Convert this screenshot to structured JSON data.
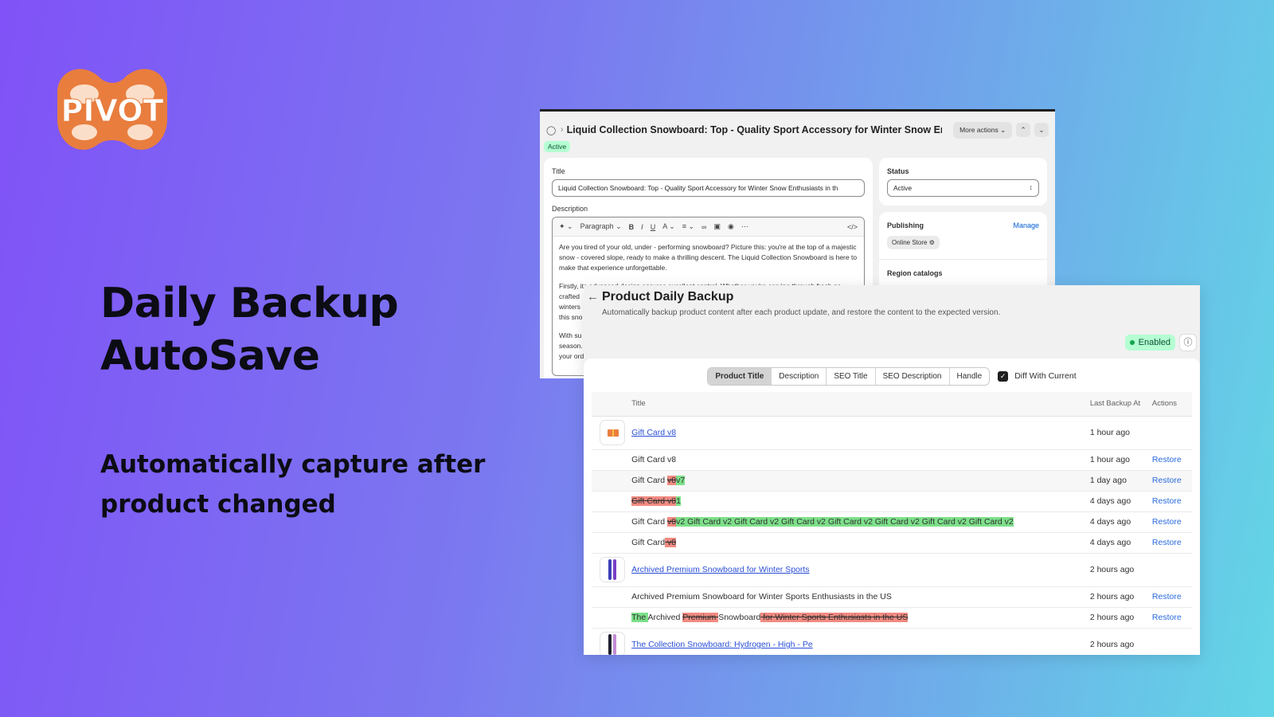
{
  "brand": {
    "logo_text": "PIVOT",
    "logo_color": "#e87d3e"
  },
  "hero": {
    "headline_line1": "Daily Backup",
    "headline_line2": "AutoSave",
    "subline_line1": "Automatically capture after",
    "subline_line2": "product changed"
  },
  "editor": {
    "breadcrumb_sep": "›",
    "product_title": "Liquid Collection Snowboard: Top - Quality Sport Accessory for Winter Snow Enth...",
    "more_actions": "More actions",
    "status_badge": "Active",
    "title_label": "Title",
    "title_value": "Liquid Collection Snowboard: Top - Quality Sport Accessory for Winter Snow Enthusiasts in th",
    "description_label": "Description",
    "toolbar_format": "Paragraph",
    "desc_p1": "Are you tired of your old, under - performing snowboard? Picture this: you're at the top of a majestic snow - covered slope, ready to make a thrilling descent. The Liquid Collection Snowboard is here to make that experience unforgettable.",
    "desc_p2": "Firstly, its advanced design ensures excellent control. Whether you're carving through fresh po",
    "desc_p2b": "crafted",
    "desc_p2c": "winters",
    "desc_p2d": "this sno",
    "desc_p3": "With su",
    "desc_p3b": "season.",
    "desc_p3c": "your ord",
    "status_label": "Status",
    "status_value": "Active",
    "publishing_label": "Publishing",
    "manage_link": "Manage",
    "online_store": "Online Store",
    "region_label": "Region catalogs"
  },
  "backup": {
    "title": "Product Daily Backup",
    "description": "Automatically backup product content after each product update, and restore the content to the expected version.",
    "enabled_badge": "Enabled",
    "tabs": [
      "Product Title",
      "Description",
      "SEO Title",
      "SEO Description",
      "Handle"
    ],
    "selected_tab": "Product Title",
    "diff_label": "Diff With Current",
    "diff_checked": true,
    "columns": {
      "title": "Title",
      "last_backup": "Last Backup At",
      "actions": "Actions"
    },
    "restore_label": "Restore",
    "rows": {
      "p1_title": "Gift Card v8",
      "p1_time": "1 hour ago",
      "r1_title": "Gift Card v8",
      "r1_time": "1 hour ago",
      "r2_pre": "Gift Card ",
      "r2_del": "v8",
      "r2_ins": "v7",
      "r2_time": "1 day ago",
      "r3_del": "Gift Card v8",
      "r3_ins": "1",
      "r3_time": "4 days ago",
      "r4_pre": "Gift Card ",
      "r4_del": "v8",
      "r4_ins": "v2 Gift Card v2 Gift Card v2 Gift Card v2 Gift Card v2 Gift Card v2 Gift Card v2 Gift Card v2",
      "r4_time": "4 days ago",
      "r5_pre": "Gift Card",
      "r5_del": " v8",
      "r5_time": "4 days ago",
      "p2_title": "Archived Premium Snowboard for Winter Sports ",
      "p2_time": "2 hours ago",
      "r6_title": "Archived Premium Snowboard for Winter Sports Enthusiasts in the US",
      "r6_time": "2 hours ago",
      "r7_ins": "The ",
      "r7_a": "Archived ",
      "r7_del1": "Premium ",
      "r7_b": "Snowboard",
      "r7_del2": " for Winter Sports Enthusiasts in the US",
      "r7_time": "2 hours ago",
      "p3_title": "The Collection Snowboard: Hydrogen - High - Pe",
      "p3_time": "2 hours ago"
    }
  },
  "colors": {
    "diff_deleted": "#f28b82",
    "diff_inserted": "#7de08a",
    "link": "#2a4fd6",
    "badge_green": "#b4fed2"
  }
}
